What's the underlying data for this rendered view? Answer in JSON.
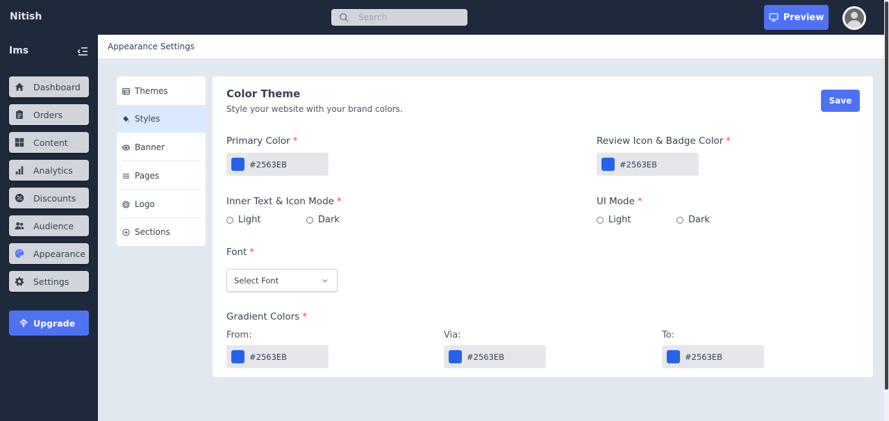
{
  "app": {
    "brand": "Nitish",
    "search_placeholder": "Search",
    "preview_label": "Preview"
  },
  "sidebar": {
    "title": "Ims",
    "items": [
      {
        "label": "Dashboard",
        "icon": "home-icon"
      },
      {
        "label": "Orders",
        "icon": "clipboard-icon"
      },
      {
        "label": "Content",
        "icon": "grid-icon"
      },
      {
        "label": "Analytics",
        "icon": "bar-chart-icon"
      },
      {
        "label": "Discounts",
        "icon": "discount-icon"
      },
      {
        "label": "Audience",
        "icon": "users-icon"
      },
      {
        "label": "Appearance",
        "icon": "palette-icon"
      },
      {
        "label": "Settings",
        "icon": "gear-icon"
      }
    ],
    "upgrade_label": "Upgrade"
  },
  "header": {
    "title": "Appearance Settings"
  },
  "submenu": {
    "items": [
      {
        "label": "Themes",
        "icon": "table-icon"
      },
      {
        "label": "Styles",
        "icon": "paint-bucket-icon",
        "active": true
      },
      {
        "label": "Banner",
        "icon": "banner-icon"
      },
      {
        "label": "Pages",
        "icon": "lines-icon"
      },
      {
        "label": "Logo",
        "icon": "fingerprint-icon"
      },
      {
        "label": "Sections",
        "icon": "circle-plus-icon"
      }
    ]
  },
  "card": {
    "title": "Color Theme",
    "subtitle": "Style your website with your brand colors.",
    "save_label": "Save",
    "required_mark": "*",
    "primary_color": {
      "label": "Primary Color",
      "value": "#2563EB"
    },
    "review_color": {
      "label": "Review Icon & Badge Color",
      "value": "#2563EB"
    },
    "inner_mode": {
      "label": "Inner Text & Icon Mode",
      "options": [
        "Light",
        "Dark"
      ]
    },
    "ui_mode": {
      "label": "UI Mode",
      "options": [
        "Light",
        "Dark"
      ]
    },
    "font": {
      "label": "Font",
      "selected": "Select Font"
    },
    "gradient": {
      "label": "Gradient Colors",
      "from": {
        "label": "From:",
        "value": "#2563EB"
      },
      "via": {
        "label": "Via:",
        "value": "#2563EB"
      },
      "to": {
        "label": "To:",
        "value": "#2563EB"
      }
    }
  },
  "colors": {
    "accent": "#4f72f5",
    "dark": "#1e293b",
    "swatch": "#2563EB",
    "required": "#ef4444"
  }
}
